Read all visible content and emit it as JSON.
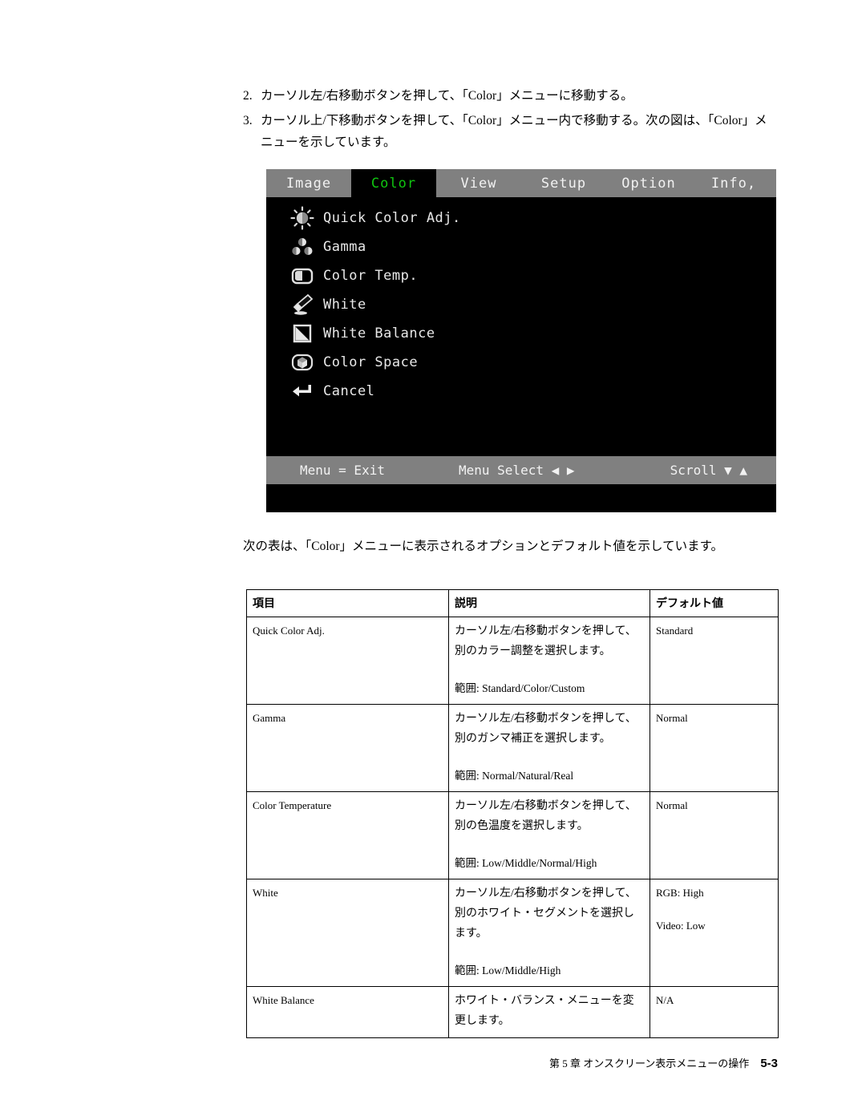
{
  "steps": [
    {
      "num": "2.",
      "text": "カーソル左/右移動ボタンを押して、「Color」メニューに移動する。"
    },
    {
      "num": "3.",
      "text": "カーソル上/下移動ボタンを押して、「Color」メニュー内で移動する。次の図は、「Color」メニューを示しています。"
    }
  ],
  "osd": {
    "tabs": [
      {
        "label": "Image",
        "active": false
      },
      {
        "label": "Color",
        "active": true
      },
      {
        "label": "View",
        "active": false
      },
      {
        "label": "Setup",
        "active": false
      },
      {
        "label": "Option",
        "active": false
      },
      {
        "label": "Info,",
        "active": false
      }
    ],
    "active_tab_color": "#10c410",
    "bar_color": "#808080",
    "background_color": "#000000",
    "items": [
      {
        "label": "Quick Color Adj.",
        "icon": "brightness-sun-icon"
      },
      {
        "label": "Gamma",
        "icon": "gamma-circles-icon"
      },
      {
        "label": "Color Temp.",
        "icon": "color-temperature-icon"
      },
      {
        "label": "White",
        "icon": "paintbrush-icon"
      },
      {
        "label": "White Balance",
        "icon": "white-balance-gradient-icon"
      },
      {
        "label": "Color Space",
        "icon": "color-space-icon"
      },
      {
        "label": "Cancel",
        "icon": "return-arrow-icon"
      }
    ],
    "footer": {
      "exit": "Menu = Exit",
      "select": "Menu Select ◀ ▶",
      "scroll": "Scroll ▼ ▲"
    }
  },
  "paragraph": "次の表は、「Color」メニューに表示されるオプションとデフォルト値を示しています。",
  "table": {
    "headers": [
      "項目",
      "説明",
      "デフォルト値"
    ],
    "rows": [
      {
        "item": "Quick Color Adj.",
        "desc": "カーソル左/右移動ボタンを押して、別のカラー調整を選択します。",
        "range": "範囲: Standard/Color/Custom",
        "default": "Standard",
        "default2": ""
      },
      {
        "item": "Gamma",
        "desc": "カーソル左/右移動ボタンを押して、別のガンマ補正を選択します。",
        "range": "範囲: Normal/Natural/Real",
        "default": "Normal",
        "default2": ""
      },
      {
        "item": "Color Temperature",
        "desc": "カーソル左/右移動ボタンを押して、別の色温度を選択します。",
        "range": "範囲: Low/Middle/Normal/High",
        "default": "Normal",
        "default2": ""
      },
      {
        "item": "White",
        "desc": "カーソル左/右移動ボタンを押して、別のホワイト・セグメントを選択します。",
        "range": "範囲: Low/Middle/High",
        "default": "RGB: High",
        "default2": "Video: Low"
      },
      {
        "item": "White Balance",
        "desc": "ホワイト・バランス・メニューを変更します。",
        "range": "",
        "default": "N/A",
        "default2": ""
      }
    ]
  },
  "page_footer": {
    "chapter": "第 5 章 オンスクリーン表示メニューの操作",
    "page": "5-3"
  }
}
